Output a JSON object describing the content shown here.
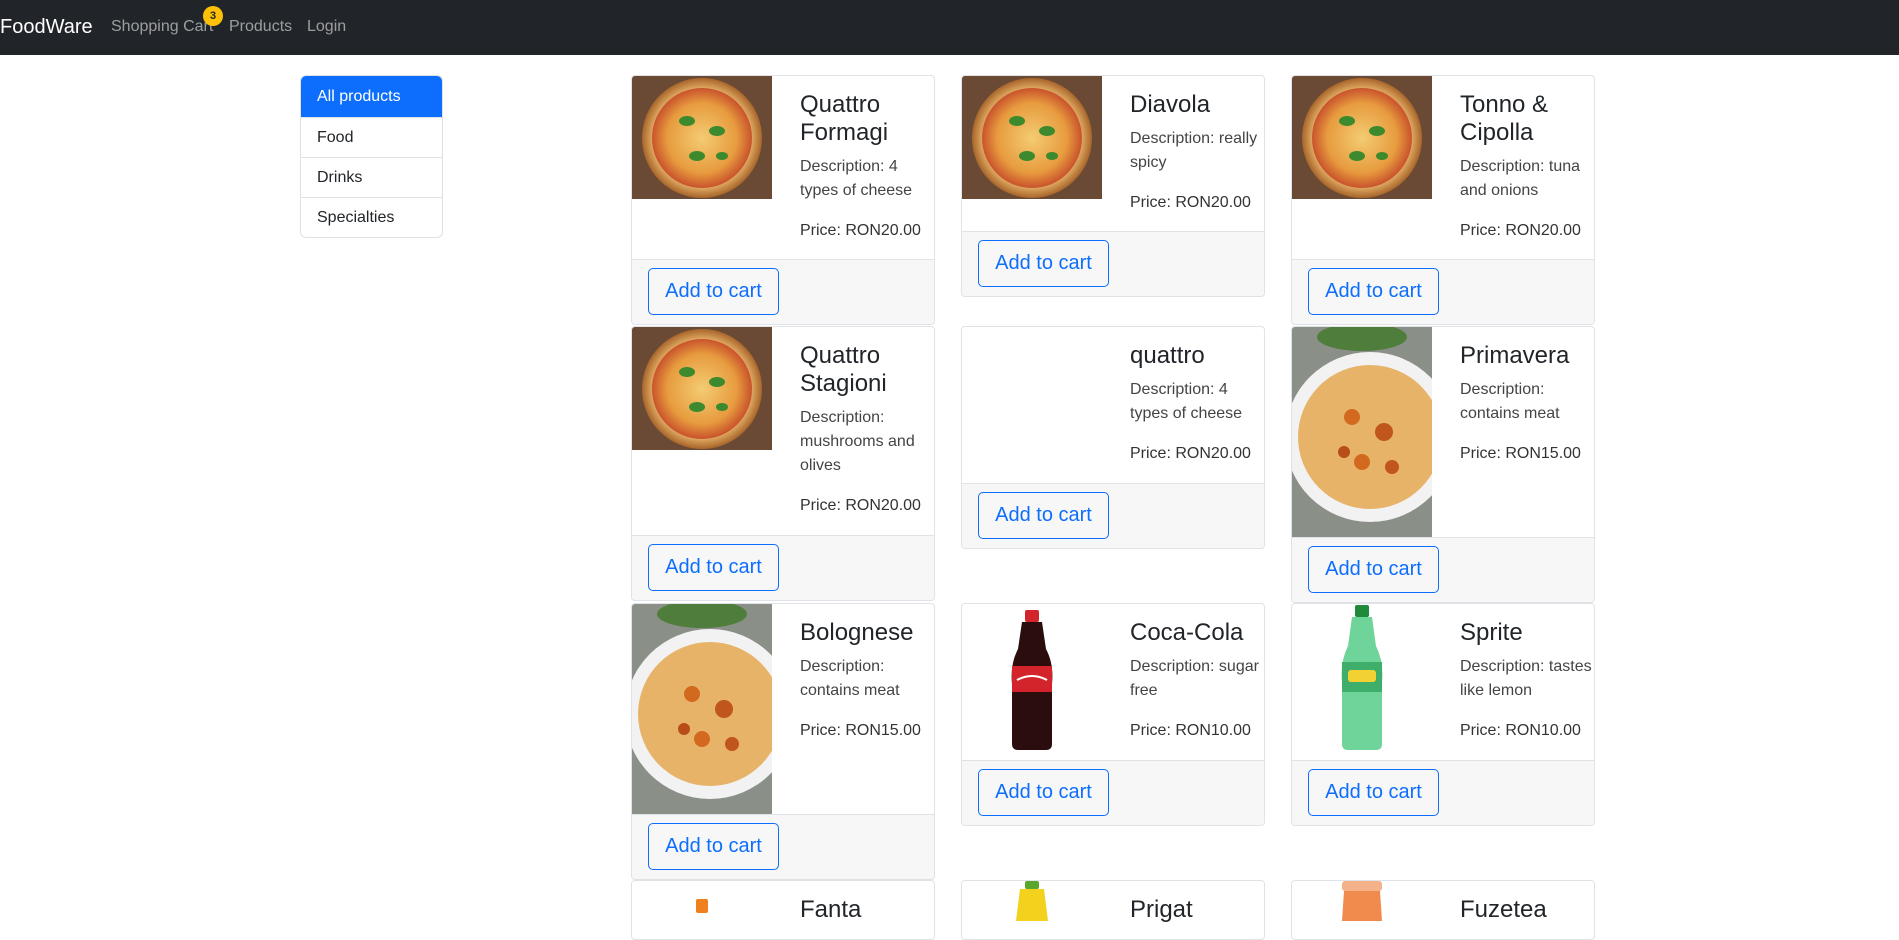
{
  "navbar": {
    "brand": "FoodWare",
    "links": [
      "Shopping Cart",
      "Products",
      "Login"
    ],
    "cart_count": "3"
  },
  "sidebar": {
    "items": [
      {
        "label": "All products",
        "active": true
      },
      {
        "label": "Food"
      },
      {
        "label": "Drinks"
      },
      {
        "label": "Specialties"
      }
    ]
  },
  "products": [
    {
      "name": "Quattro Formagi",
      "description": "Description: 4 types of cheese",
      "price": "Price: RON20.00",
      "button": "Add to cart",
      "image": "pizza"
    },
    {
      "name": "Diavola",
      "description": "Description: really spicy",
      "price": "Price: RON20.00",
      "button": "Add to cart",
      "image": "pizza"
    },
    {
      "name": "Tonno & Cipolla",
      "description": "Description: tuna and onions",
      "price": "Price: RON20.00",
      "button": "Add to cart",
      "image": "pizza"
    },
    {
      "name": "Quattro Stagioni",
      "description": "Description: mushrooms and olives",
      "price": "Price: RON20.00",
      "button": "Add to cart",
      "image": "pizza"
    },
    {
      "name": "quattro",
      "description": "Description: 4 types of cheese",
      "price": "Price: RON20.00",
      "button": "Add to cart",
      "image": "none"
    },
    {
      "name": "Primavera",
      "description": "Description: contains meat",
      "price": "Price: RON15.00",
      "button": "Add to cart",
      "image": "pasta"
    },
    {
      "name": "Bolognese",
      "description": "Description: contains meat",
      "price": "Price: RON15.00",
      "button": "Add to cart",
      "image": "pasta"
    },
    {
      "name": "Coca-Cola",
      "description": "Description: sugar free",
      "price": "Price: RON10.00",
      "button": "Add to cart",
      "image": "cola-bottle"
    },
    {
      "name": "Sprite",
      "description": "Description: tastes like lemon",
      "price": "Price: RON10.00",
      "button": "Add to cart",
      "image": "sprite-bottle"
    },
    {
      "name": "Fanta",
      "description": "",
      "price": "",
      "button": "",
      "image": "fanta-bottle"
    },
    {
      "name": "Prigat",
      "description": "",
      "price": "",
      "button": "",
      "image": "prigat-bottle"
    },
    {
      "name": "Fuzetea",
      "description": "",
      "price": "",
      "button": "",
      "image": "fuzetea-bottle"
    }
  ]
}
